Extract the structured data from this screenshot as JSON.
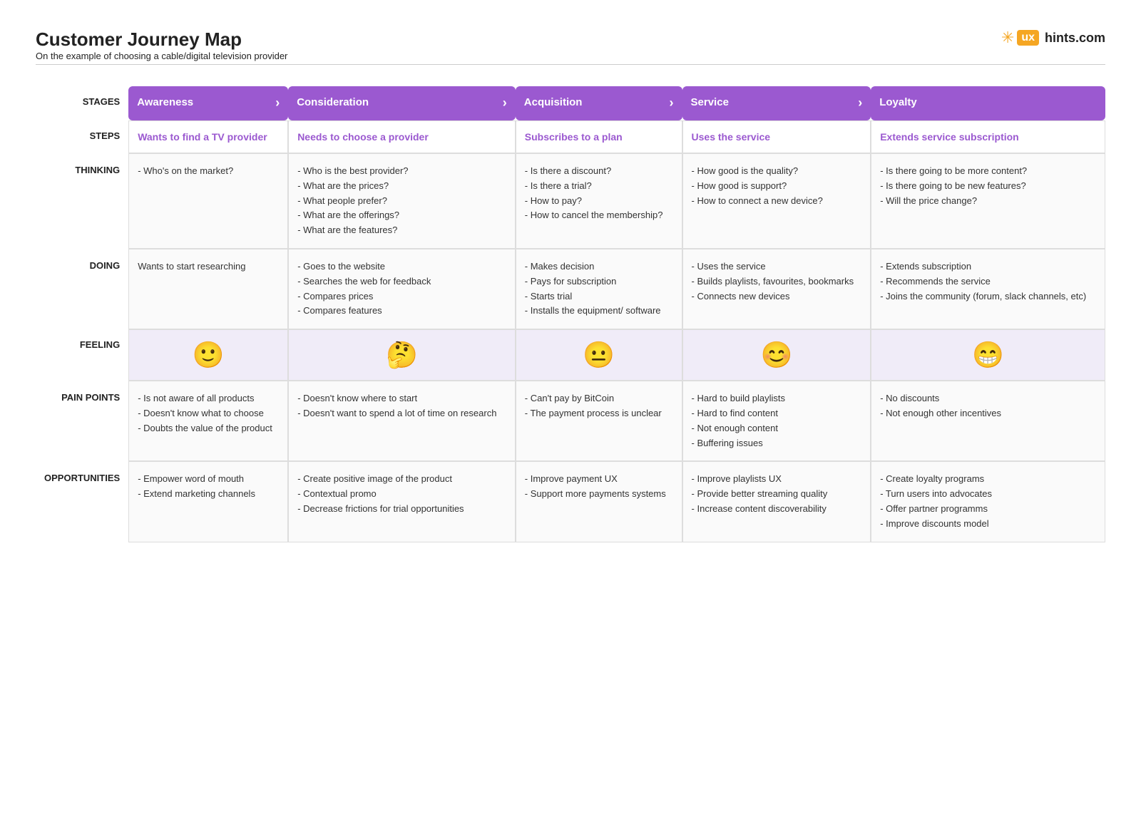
{
  "header": {
    "title": "Customer Journey Map",
    "subtitle": "On the example of choosing a cable/digital television provider",
    "logo_ux": "ux",
    "logo_text": "hints.com",
    "logo_spark": "✳"
  },
  "row_labels": {
    "stages": "STAGES",
    "steps": "STEPS",
    "thinking": "THINKING",
    "doing": "DOING",
    "feeling": "FEELING",
    "pain_points": "PAIN POINTS",
    "opportunities": "OPPORTUNITIES"
  },
  "stages": [
    {
      "label": "Awareness",
      "has_chevron": true
    },
    {
      "label": "Consideration",
      "has_chevron": true
    },
    {
      "label": "Acquisition",
      "has_chevron": true
    },
    {
      "label": "Service",
      "has_chevron": true
    },
    {
      "label": "Loyalty",
      "has_chevron": false
    }
  ],
  "steps": [
    "Wants to find a TV provider",
    "Needs to choose a provider",
    "Subscribes to a plan",
    "Uses the service",
    "Extends  service subscription"
  ],
  "thinking": [
    "- Who's on the market?",
    "- Who is the best provider?\n- What are the prices?\n- What people prefer?\n- What are the offerings?\n- What are the features?",
    "- Is there a discount?\n- Is there a trial?\n- How to pay?\n- How to cancel the membership?",
    "- How good is the quality?\n- How good is support?\n- How to connect a new device?",
    "- Is there going to be more content?\n- Is there going to be new features?\n- Will the price change?"
  ],
  "doing": [
    "Wants to start researching",
    "- Goes to the website\n- Searches the web for feedback\n- Compares prices\n- Compares features",
    "- Makes decision\n- Pays for subscription\n- Starts trial\n- Installs the equipment/ software",
    "- Uses the service\n- Builds playlists, favourites, bookmarks\n- Connects new devices",
    "- Extends subscription\n- Recommends the service\n- Joins the community (forum, slack channels, etc)"
  ],
  "feelings": [
    "🙂",
    "🤔",
    "😐",
    "😊",
    "😁"
  ],
  "pain_points": [
    "- Is not aware of all products\n- Doesn't know what to choose\n- Doubts the value of the product",
    "- Doesn't know where to start\n- Doesn't want to spend a lot of time on research",
    "- Can't pay by BitCoin\n- The payment process is unclear",
    "- Hard to build playlists\n- Hard to find content\n- Not enough content\n- Buffering issues",
    "- No discounts\n- Not enough other incentives"
  ],
  "opportunities": [
    "- Empower word of mouth\n- Extend marketing channels",
    "- Create positive image of the product\n- Contextual promo\n- Decrease frictions for trial opportunities",
    "- Improve payment UX\n- Support more payments systems",
    "- Improve playlists UX\n- Provide better streaming quality\n- Increase content discoverability",
    "- Create loyalty programs\n- Turn users into advocates\n- Offer partner programms\n- Improve discounts model"
  ],
  "colors": {
    "purple": "#9b59d0",
    "light_purple_bg": "#f0ecf8",
    "cell_bg": "#fafafa"
  }
}
